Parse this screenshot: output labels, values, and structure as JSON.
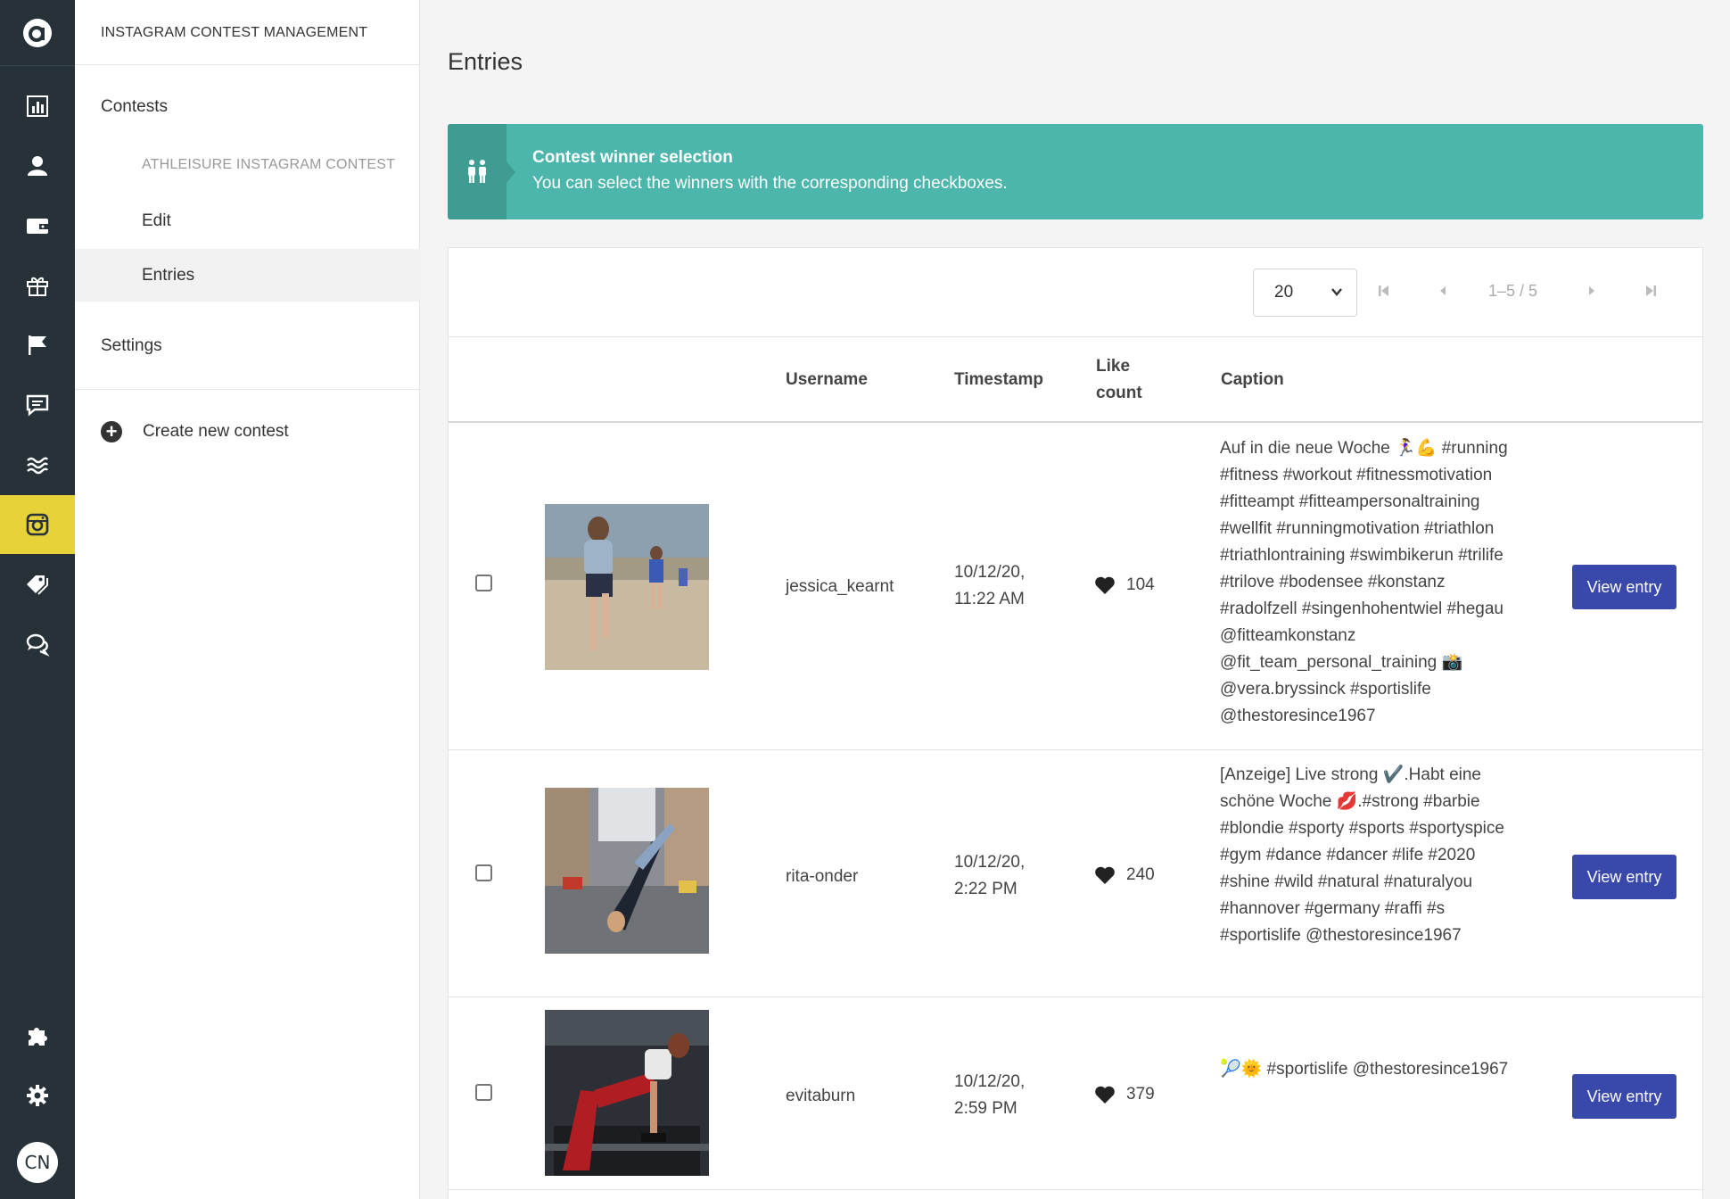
{
  "rail": {
    "logo": "a",
    "items": [
      "chart-icon",
      "user-icon",
      "wallet-icon",
      "gift-icon",
      "flag-icon",
      "comment-icon",
      "waves-icon",
      "instagram-icon",
      "tags-icon",
      "chat-bubbles-icon"
    ],
    "bottom": [
      "puzzle-icon",
      "gear-icon"
    ],
    "avatar": "CN",
    "active_color": "#e8d23a",
    "bg_color": "#263238"
  },
  "sidebar": {
    "title": "INSTAGRAM CONTEST MANAGEMENT",
    "contests_label": "Contests",
    "contest_name": "ATHLEISURE INSTAGRAM CONTEST",
    "edit_label": "Edit",
    "entries_label": "Entries",
    "settings_label": "Settings",
    "create_label": "Create new contest"
  },
  "page": {
    "title": "Entries"
  },
  "banner": {
    "title": "Contest winner selection",
    "text": "You can select the winners with the corresponding checkboxes.",
    "color": "#4db6ac"
  },
  "pagination": {
    "per_page": "20",
    "info": "1–5 / 5"
  },
  "table": {
    "headers": {
      "username": "Username",
      "timestamp": "Timestamp",
      "likes_line1": "Like",
      "likes_line2": "count",
      "caption": "Caption"
    },
    "rows": [
      {
        "username": "jessica_kearnt",
        "date": "10/12/20,",
        "time": "11:22 AM",
        "likes": "104",
        "caption": "Auf in die neue Woche 🏃‍♀️💪 #running #fitness #workout #fitnessmotivation #fitteampt #fitteampersonaltraining #wellfit #runningmotivation #triathlon #triathlontraining #swimbikerun #trilife #trilove #bodensee #konstanz #radolfzell #singenhohentwiel #hegau @fitteamkonstanz @fit_team_personal_training 📸 @vera.bryssinck #sportislife @thestoresince1967",
        "button": "View entry"
      },
      {
        "username": "rita-onder",
        "date": "10/12/20,",
        "time": "2:22 PM",
        "likes": "240",
        "caption": "[Anzeige] Live strong ✔️.Habt eine schöne Woche 💋.#strong #barbie #blondie #sporty #sports #sportyspice #gym #dance #dancer #life #2020 #shine #wild #natural #naturalyou #hannover #germany #raffi #s #sportislife @thestoresince1967",
        "button": "View entry"
      },
      {
        "username": "evitaburn",
        "date": "10/12/20,",
        "time": "2:59 PM",
        "likes": "379",
        "caption": "🎾🌞 #sportislife @thestoresince1967",
        "button": "View entry"
      }
    ]
  }
}
